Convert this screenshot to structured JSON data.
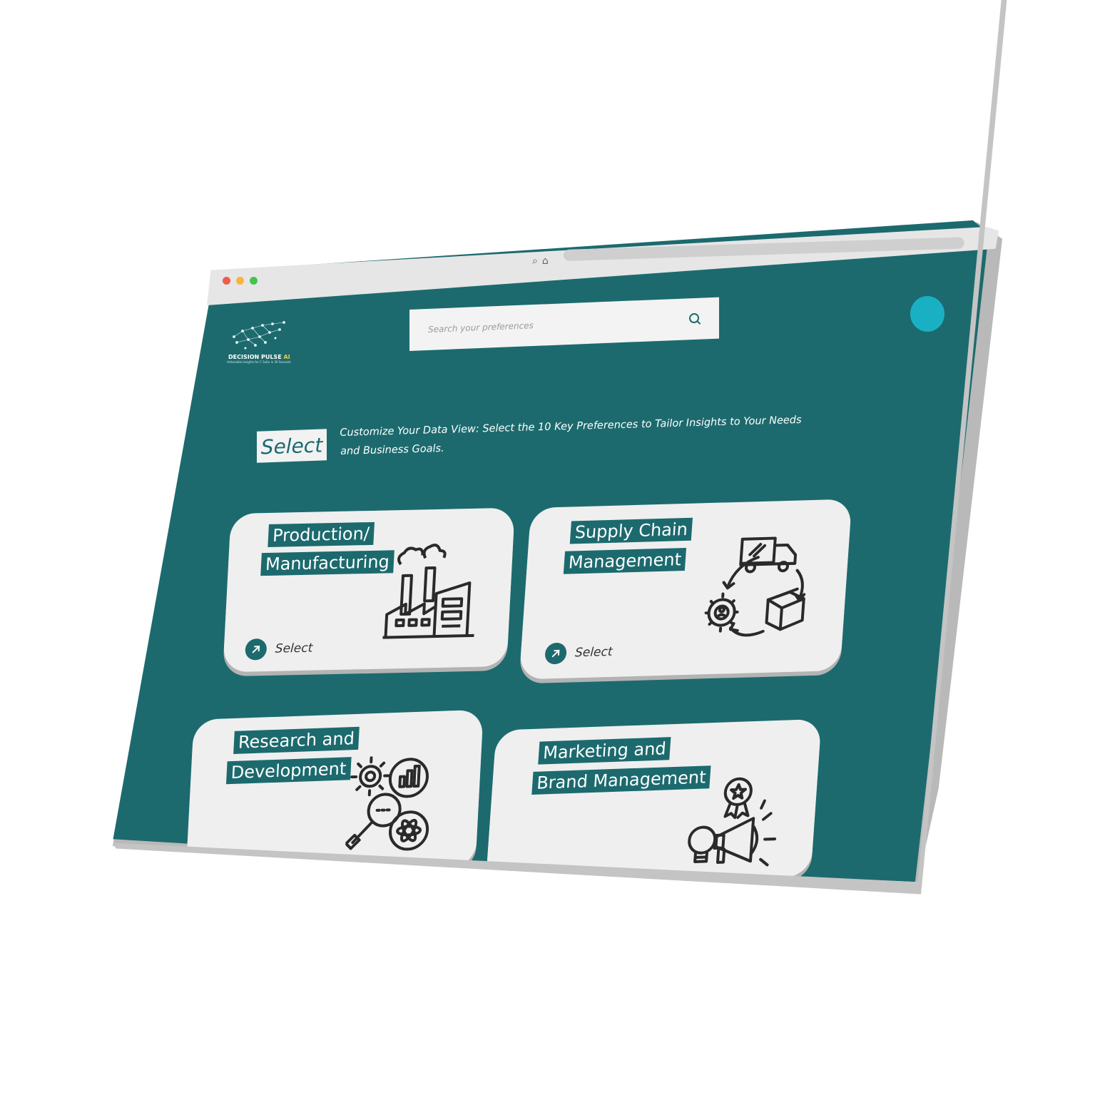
{
  "browser": {
    "controls": [
      "close",
      "minimize",
      "maximize"
    ],
    "icons": [
      "search-icon",
      "home-icon",
      "site-settings-icon",
      "kebab-menu-icon"
    ]
  },
  "brand": {
    "name": "DECISION PULSE",
    "name_accent": "AI",
    "tagline": "Actionable Insights for C Suite in 30 Seconds",
    "accent_color": "#f2c744"
  },
  "search": {
    "placeholder": "Search your preferences"
  },
  "intro": {
    "badge": "Select",
    "text": "Customize Your Data View: Select the 10 Key Preferences to Tailor Insights to Your Needs and Business Goals."
  },
  "cards": [
    {
      "title_line1": "Production/",
      "title_line2": "Manufacturing",
      "action": "Select",
      "icon": "factory-icon"
    },
    {
      "title_line1": "Supply Chain",
      "title_line2": "Management",
      "action": "Select",
      "icon": "supply-chain-cycle-icon"
    },
    {
      "title_line1": "Research and",
      "title_line2": "Development",
      "action": "",
      "icon": "research-icon"
    },
    {
      "title_line1": "Marketing and",
      "title_line2": "Brand Management",
      "action": "",
      "icon": "marketing-megaphone-icon"
    }
  ],
  "colors": {
    "background": "#1c6a6e",
    "card": "#efefef",
    "avatar": "#1ab0c4",
    "chrome": "#e6e6e6"
  }
}
